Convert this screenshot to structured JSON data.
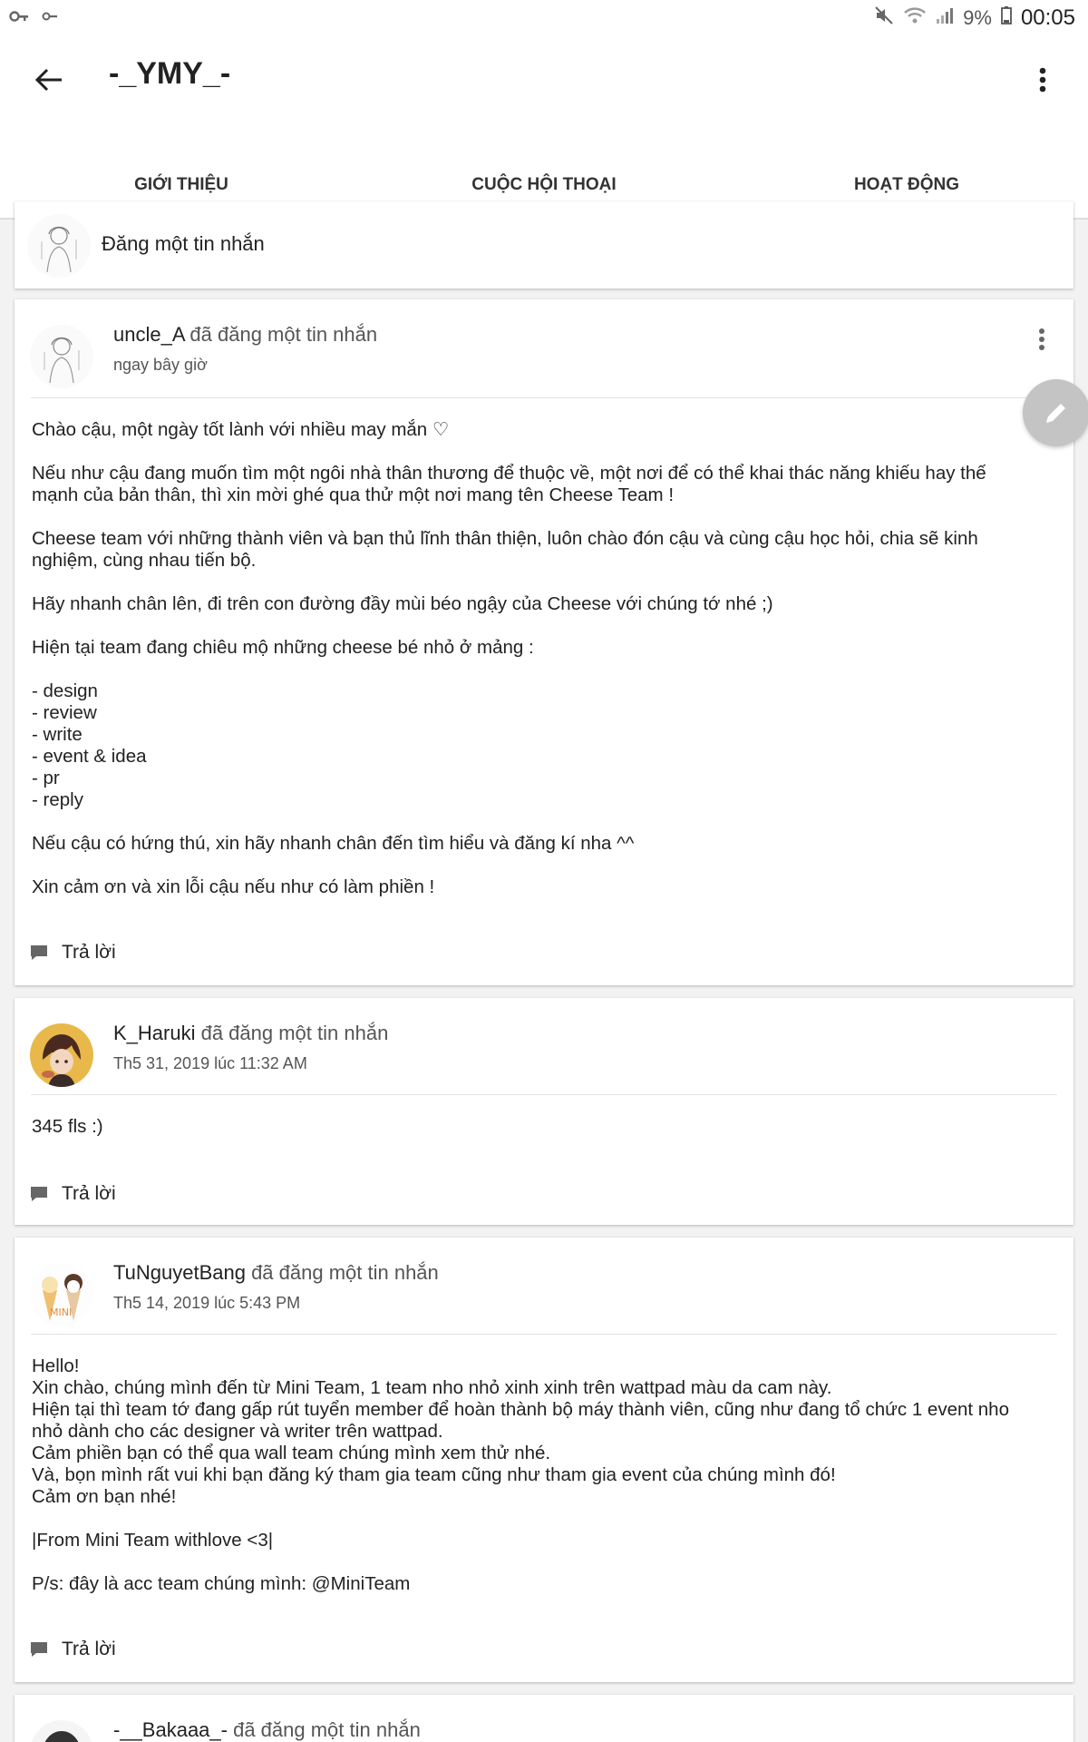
{
  "status_bar": {
    "battery": "9%",
    "time": "00:05"
  },
  "app_bar": {
    "title": "-_YMY_-"
  },
  "tabs": [
    {
      "label": "GIỚI THIỆU",
      "active": false
    },
    {
      "label": "CUỘC HỘI THOẠI",
      "active": true
    },
    {
      "label": "HOẠT ĐỘNG",
      "active": false
    }
  ],
  "colors": {
    "accent": "#f16a2b",
    "fab": "#c4c4c4"
  },
  "compose": {
    "label": "Đăng một tin nhắn"
  },
  "posts": [
    {
      "author": "uncle_A",
      "action": " đã đăng một tin nhắn",
      "time": "ngay bây giờ",
      "body": "Chào cậu, một ngày tốt lành với nhiều may mắn ♡\n\nNếu như cậu đang muốn tìm một ngôi nhà thân thương để thuộc về, một nơi để có thể khai thác năng khiếu hay thế mạnh của bản thân, thì xin mời ghé qua thử một nơi mang tên Cheese Team !\n\nCheese team với những thành viên và bạn thủ lĩnh thân thiện, luôn chào đón cậu và cùng cậu học hỏi, chia sẽ kinh nghiệm, cùng nhau tiến bộ.\n\nHãy nhanh chân lên, đi trên con đường đầy mùi béo ngậy của Cheese với chúng tớ nhé ;)\n\nHiện tại team đang chiêu mộ những cheese bé nhỏ ở mảng :\n\n- design\n- review\n- write\n- event & idea\n- pr\n- reply\n\nNếu cậu có hứng thú, xin hãy nhanh chân đến tìm hiểu và đăng kí nha ^^\n\nXin cảm ơn và xin lỗi cậu nếu như có làm phiền !",
      "reply_label": "Trả lời"
    },
    {
      "author": "K_Haruki",
      "action": " đã đăng một tin nhắn",
      "time": "Th5 31, 2019 lúc 11:32 AM",
      "body": "345 fls :)",
      "reply_label": "Trả lời"
    },
    {
      "author": "TuNguyetBang",
      "action": " đã đăng một tin nhắn",
      "time": "Th5 14, 2019 lúc 5:43 PM",
      "body": "Hello!\nXin chào, chúng mình đến từ Mini Team, 1 team nho nhỏ xinh xinh trên wattpad màu da cam này.\nHiện tại thì team tớ đang gấp rút tuyển member để hoàn thành bộ máy thành viên, cũng như đang tổ chức 1 event nho nhỏ dành cho các designer và writer trên wattpad.\nCảm phiền bạn có thể qua wall team chúng mình xem thử nhé.\nVà, bọn mình rất vui khi bạn đăng ký tham gia team cũng như tham gia event của chúng mình đó!\nCảm ơn bạn nhé!\n\n|From Mini Team withlove <3|\n\nP/s: đây là acc team chúng mình: @MiniTeam",
      "reply_label": "Trả lời"
    },
    {
      "author": "-__Bakaaa_-",
      "action": " đã đăng một tin nhắn"
    }
  ]
}
